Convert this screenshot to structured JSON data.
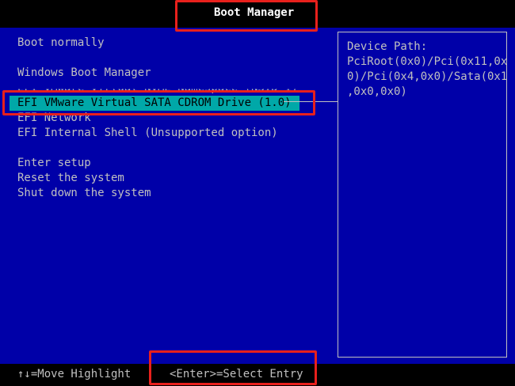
{
  "header": {
    "title": "Boot Manager"
  },
  "menu": {
    "items": [
      {
        "label": "Boot normally"
      },
      {
        "label": "Windows Boot Manager"
      },
      {
        "label": "EFI VMware Virtual NVME Namespace (NSID 1)"
      },
      {
        "label": "EFI VMware Virtual SATA CDROM Drive (1.0)",
        "selected": true
      },
      {
        "label": "EFI Network"
      },
      {
        "label": "EFI Internal Shell (Unsupported option)"
      },
      {
        "label": "Enter setup"
      },
      {
        "label": "Reset the system"
      },
      {
        "label": "Shut down the system"
      }
    ]
  },
  "info": {
    "heading": "Device Path:",
    "lines": [
      "PciRoot(0x0)/Pci(0x11,0x",
      "0)/Pci(0x4,0x0)/Sata(0x1",
      ",0x0,0x0)"
    ]
  },
  "footer": {
    "move_hint": "↑↓=Move Highlight",
    "select_hint": "<Enter>=Select Entry"
  },
  "colors": {
    "background": "#0000a8",
    "selection": "#00a8a8",
    "text": "#c0c0c0",
    "title_text": "#ffffff",
    "annotation": "#e8201c"
  }
}
